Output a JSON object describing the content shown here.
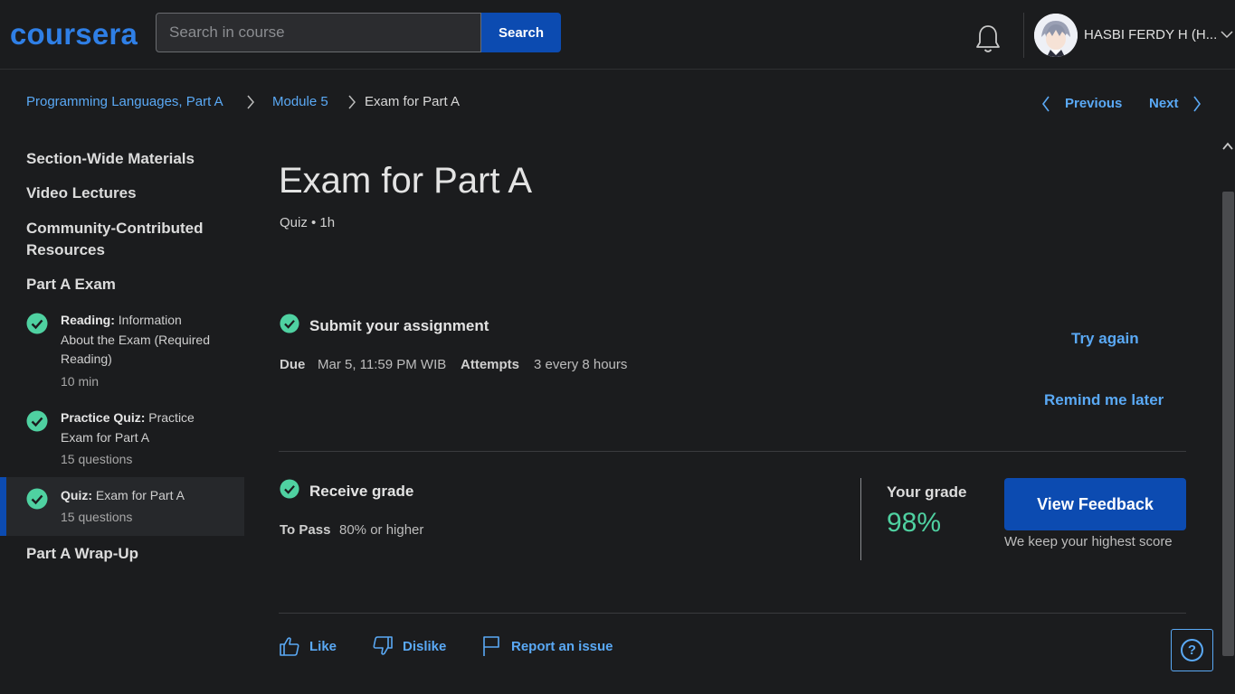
{
  "header": {
    "logo": "coursera",
    "search_placeholder": "Search in course",
    "search_button": "Search",
    "user_name": "HASBI FERDY H (H...",
    "icons": [
      "bell-icon",
      "chevron-down-icon"
    ]
  },
  "breadcrumb": {
    "items": [
      "Programming Languages, Part A",
      "Module 5",
      "Exam for Part A"
    ],
    "previous": "Previous",
    "next": "Next"
  },
  "sidebar": {
    "sections": [
      "Section-Wide Materials",
      "Video Lectures",
      "Community-Contributed Resources",
      "Part A Exam",
      "Part A Wrap-Up"
    ],
    "items": [
      {
        "type": "Reading:",
        "title": "Information About the Exam (Required Reading)",
        "meta": "10 min"
      },
      {
        "type": "Practice Quiz:",
        "title": "Practice Exam for Part A",
        "meta": "15 questions"
      },
      {
        "type": "Quiz:",
        "title": "Exam for Part A",
        "meta": "15 questions"
      }
    ]
  },
  "main": {
    "title": "Exam for Part A",
    "meta": "Quiz • 1h",
    "submit": {
      "title": "Submit your assignment",
      "due_label": "Due",
      "due_value": "Mar 5, 11:59 PM WIB",
      "attempts_label": "Attempts",
      "attempts_value": "3 every 8 hours",
      "try_again": "Try again",
      "remind_later": "Remind me later"
    },
    "grade": {
      "title": "Receive grade",
      "pass_label": "To Pass",
      "pass_value": "80% or higher",
      "your_grade_label": "Your grade",
      "your_grade_value": "98%",
      "view_feedback": "View Feedback",
      "keep_note": "We keep your highest score"
    },
    "footer": {
      "like": "Like",
      "dislike": "Dislike",
      "report": "Report an issue",
      "help": "?"
    }
  },
  "colors": {
    "background": "#1b1c1e",
    "accent_blue": "#0c4bb1",
    "link_blue": "#5aa9f5",
    "success_green": "#4fd1a1"
  }
}
